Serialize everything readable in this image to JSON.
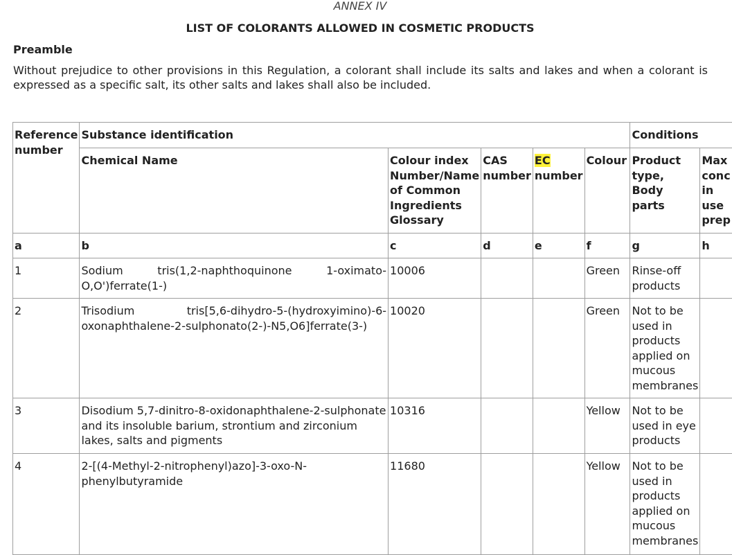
{
  "document": {
    "annex_label": "ANNEX IV",
    "title": "LIST OF COLORANTS ALLOWED IN COSMETIC PRODUCTS",
    "preamble_heading": "Preamble",
    "preamble_text": "Without prejudice to other provisions in this Regulation, a colorant shall include its salts and lakes and when a colorant is expressed as a specific salt, its other salts and lakes shall also be included."
  },
  "table": {
    "headers": {
      "reference_number": "Reference number",
      "substance_identification": "Substance identification",
      "conditions": "Conditions",
      "chemical_name": "Chemical Name",
      "colour_index": "Colour index Number/Name of Common Ingredients Glossary",
      "cas_number": "CAS number",
      "ec_label": "EC",
      "ec_number": "number",
      "colour": "Colour",
      "product_type": "Product type, Body parts",
      "max_conc_lines": [
        "Max",
        "conc",
        "in",
        "use",
        "prep"
      ]
    },
    "letters": [
      "a",
      "b",
      "c",
      "d",
      "e",
      "f",
      "g",
      "h"
    ],
    "rows": [
      {
        "ref": "1",
        "chemical_name_line1": "Sodium tris(1,2-naphthoquinone 1-oximato-",
        "chemical_name_line2": "O,O')ferrate(1-)",
        "colour_index": "10006",
        "cas": "",
        "ec": "",
        "colour": "Green",
        "product_type": "Rinse-off products",
        "max_conc": ""
      },
      {
        "ref": "2",
        "chemical_name_line1": "Trisodium tris[5,6-dihydro-5-(hydroxyimino)-6-",
        "chemical_name_line2": "oxonaphthalene-2-sulphonato(2-)-N5,O6]ferrate(3-)",
        "colour_index": "10020",
        "cas": "",
        "ec": "",
        "colour": "Green",
        "product_type": "Not to be used in products applied on mucous membranes",
        "max_conc": ""
      },
      {
        "ref": "3",
        "chemical_name": "Disodium 5,7-dinitro-8-oxidonaphthalene-2-sulphonate and its insoluble barium, strontium and zirconium lakes, salts and pigments",
        "colour_index": "10316",
        "cas": "",
        "ec": "",
        "colour": "Yellow",
        "product_type": "Not to be used in eye products",
        "max_conc": ""
      },
      {
        "ref": "4",
        "chemical_name_line1": "2-[(4-Methyl-2-nitrophenyl)azo]-3-oxo-N-",
        "chemical_name_line2": "phenylbutyramide",
        "colour_index": "11680",
        "cas": "",
        "ec": "",
        "colour": "Yellow",
        "product_type": "Not to be used in products applied on mucous membranes",
        "max_conc": ""
      }
    ]
  },
  "colors": {
    "highlight": "#fff23a",
    "border": "#9e9e9e",
    "text": "#222222"
  }
}
